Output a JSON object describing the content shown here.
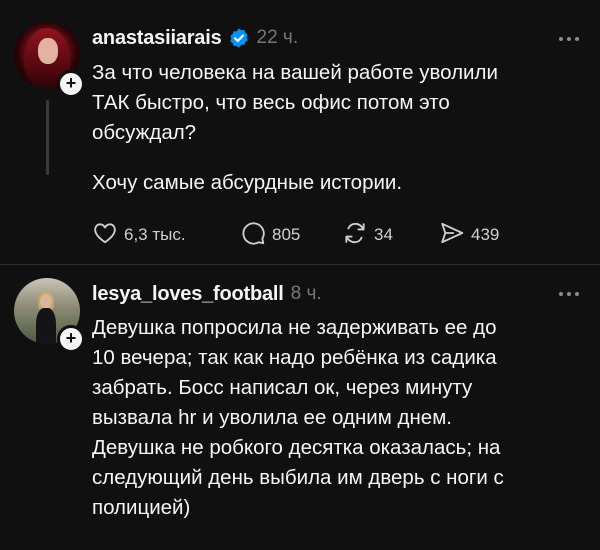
{
  "posts": [
    {
      "username": "anastasiiarais",
      "verified": true,
      "time": "22 ч.",
      "text_lines_1": [
        "За что человека на вашей работе уволили",
        "ТАК быстро, что весь офис потом это",
        "обсуждал?"
      ],
      "text_lines_2": [
        "Хочу самые абсурдные истории."
      ],
      "actions": {
        "likes": "6,3 тыс.",
        "replies": "805",
        "reposts": "34",
        "shares": "439"
      }
    },
    {
      "username": "lesya_loves_football",
      "verified": false,
      "time": "8 ч.",
      "text_lines": [
        "Девушка попросила не задерживать ее до",
        "10 вечера; так как надо ребёнка из садика",
        "забрать. Босс написал ок, через минуту",
        "вызвала hr и уволила ее одним днем.",
        "Девушка не робкого десятка оказалась; на",
        "следующий день выбила им дверь с ноги с",
        "полицией)"
      ]
    }
  ],
  "icons": {
    "verified": "verified-badge-icon",
    "more": "more-options-icon",
    "like": "heart-icon",
    "reply": "comment-icon",
    "repost": "repost-icon",
    "share": "send-icon",
    "follow": "plus-icon"
  },
  "colors": {
    "background": "#101010",
    "text": "#f3f5f7",
    "secondary": "#777777",
    "verified": "#0095f6",
    "divider": "#2b2b2b"
  }
}
